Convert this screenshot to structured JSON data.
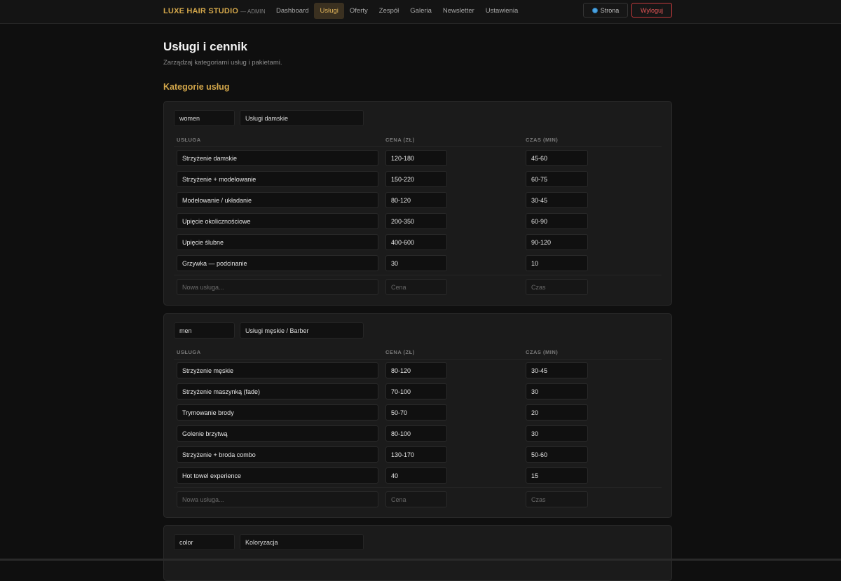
{
  "header": {
    "brand": "LUXE HAIR STUDIO",
    "brand_sub": "— ADMIN",
    "nav": [
      {
        "label": "Dashboard",
        "active": false
      },
      {
        "label": "Usługi",
        "active": true
      },
      {
        "label": "Oferty",
        "active": false
      },
      {
        "label": "Zespół",
        "active": false
      },
      {
        "label": "Galeria",
        "active": false
      },
      {
        "label": "Newsletter",
        "active": false
      },
      {
        "label": "Ustawienia",
        "active": false
      }
    ],
    "site_button": "Strona",
    "site_icon": "globe-icon",
    "logout_button": "Wyloguj"
  },
  "page": {
    "title": "Usługi i cennik",
    "subtitle": "Zarządzaj kategoriami usług i pakietami.",
    "section_title": "Kategorie usług"
  },
  "table_headers": {
    "service": "USŁUGA",
    "price": "CENA (ZŁ)",
    "time": "CZAS (MIN)"
  },
  "placeholders": {
    "service": "Nowa usługa...",
    "price": "Cena",
    "time": "Czas"
  },
  "categories": [
    {
      "key": "women",
      "name": "Usługi damskie",
      "services": [
        {
          "name": "Strzyżenie damskie",
          "price": "120-180",
          "time": "45-60"
        },
        {
          "name": "Strzyżenie + modelowanie",
          "price": "150-220",
          "time": "60-75"
        },
        {
          "name": "Modelowanie / układanie",
          "price": "80-120",
          "time": "30-45"
        },
        {
          "name": "Upięcie okolicznościowe",
          "price": "200-350",
          "time": "60-90"
        },
        {
          "name": "Upięcie ślubne",
          "price": "400-600",
          "time": "90-120"
        },
        {
          "name": "Grzywka — podcinanie",
          "price": "30",
          "time": "10"
        }
      ]
    },
    {
      "key": "men",
      "name": "Usługi męskie / Barber",
      "services": [
        {
          "name": "Strzyżenie męskie",
          "price": "80-120",
          "time": "30-45"
        },
        {
          "name": "Strzyżenie maszynką (fade)",
          "price": "70-100",
          "time": "30"
        },
        {
          "name": "Trymowanie brody",
          "price": "50-70",
          "time": "20"
        },
        {
          "name": "Golenie brzytwą",
          "price": "80-100",
          "time": "30"
        },
        {
          "name": "Strzyżenie + broda combo",
          "price": "130-170",
          "time": "50-60"
        },
        {
          "name": "Hot towel experience",
          "price": "40",
          "time": "15"
        }
      ]
    },
    {
      "key": "color",
      "name": "Koloryzacja",
      "services": []
    }
  ],
  "colors": {
    "accent": "#d2a64a",
    "danger": "#e25556",
    "background": "#0f0f0f",
    "card": "#1b1b1b"
  }
}
